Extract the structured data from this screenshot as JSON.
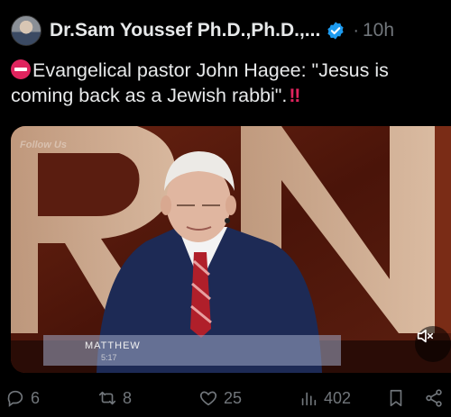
{
  "author": {
    "name": "Dr.Sam Youssef Ph.D.,Ph.D.,...",
    "time": "10h",
    "separator": "·"
  },
  "tweet": {
    "text": "Evangelical pastor John Hagee: \"Jesus is coming back as a Jewish rabbi\".",
    "trailing_emoji": "‼"
  },
  "media": {
    "watermark": "Follow Us",
    "lower_third_title": "MATTHEW",
    "lower_third_sub": "5:17",
    "mute_icon": "speaker-muted-icon"
  },
  "actions": {
    "replies": "6",
    "reposts": "8",
    "likes": "25",
    "views": "402"
  },
  "colors": {
    "background": "#000000",
    "text": "#e7e9ea",
    "muted": "#71767b",
    "verified": "#1d9bf0",
    "emoji_red": "#e0245e"
  }
}
